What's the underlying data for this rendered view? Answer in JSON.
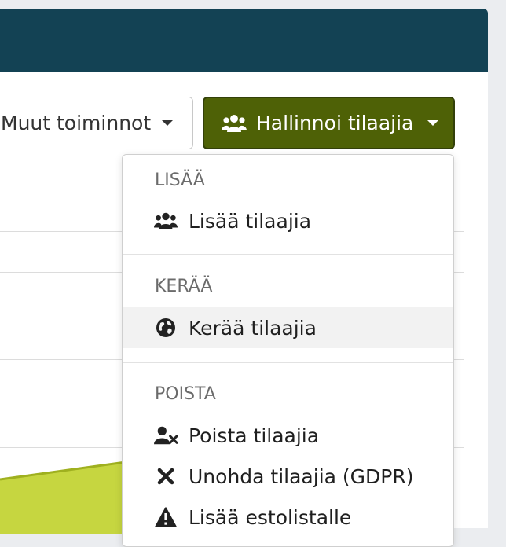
{
  "toolbar": {
    "other_actions_label": "Muut toiminnot",
    "manage_subscribers_label": "Hallinnoi tilaajia"
  },
  "menu": {
    "sections": [
      {
        "header": "LISÄÄ",
        "items": [
          {
            "label": "Lisää tilaajia",
            "icon": "users-icon"
          }
        ]
      },
      {
        "header": "KERÄÄ",
        "items": [
          {
            "label": "Kerää tilaajia",
            "icon": "globe-icon"
          }
        ]
      },
      {
        "header": "POISTA",
        "items": [
          {
            "label": "Poista tilaajia",
            "icon": "user-remove-icon"
          },
          {
            "label": "Unohda tilaajia (GDPR)",
            "icon": "close-icon"
          },
          {
            "label": "Lisää estolistalle",
            "icon": "warning-icon"
          }
        ]
      }
    ]
  },
  "colors": {
    "topbar": "#134254",
    "primary_button": "#4e6106",
    "chart_fill": "#c6d640",
    "hover_row": "#f2f2f2"
  }
}
